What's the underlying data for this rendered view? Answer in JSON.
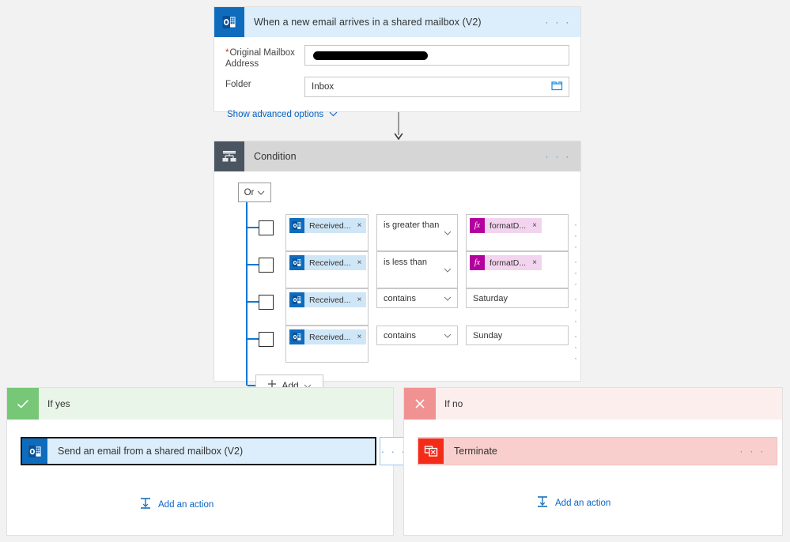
{
  "trigger": {
    "title": "When a new email arrives in a shared mailbox (V2)",
    "icon": "outlook-icon",
    "menu": "· · ·",
    "fields": [
      {
        "label": "Original Mailbox Address",
        "required": true,
        "value": "",
        "redacted": true
      },
      {
        "label": "Folder",
        "required": false,
        "value": "Inbox",
        "redacted": false,
        "trailing_icon": "folder-picker-icon"
      }
    ],
    "advanced_options_label": "Show advanced options"
  },
  "condition": {
    "title": "Condition",
    "icon": "condition-icon",
    "menu": "· · ·",
    "group_operator": "Or",
    "rows": [
      {
        "operand": "Received...",
        "operand_icon": "outlook-icon",
        "operator": "is greater than",
        "value_token": "formatD...",
        "value_token_icon": "function-icon",
        "value_text": null,
        "menu": "· · ·",
        "checked": false
      },
      {
        "operand": "Received...",
        "operand_icon": "outlook-icon",
        "operator": "is less than",
        "value_token": "formatD...",
        "value_token_icon": "function-icon",
        "value_text": null,
        "menu": "· · ·",
        "checked": false
      },
      {
        "operand": "Received...",
        "operand_icon": "outlook-icon",
        "operator": "contains",
        "value_token": null,
        "value_text": "Saturday",
        "menu": "· · ·",
        "checked": false
      },
      {
        "operand": "Received...",
        "operand_icon": "outlook-icon",
        "operator": "contains",
        "value_token": null,
        "value_text": "Sunday",
        "menu": "· · ·",
        "checked": false
      }
    ],
    "add_label": "Add",
    "remove_token_label": "×"
  },
  "branches": {
    "yes": {
      "label": "If yes",
      "icon": "checkmark-icon",
      "action": {
        "label": "Send an email from a shared mailbox (V2)",
        "icon": "outlook-icon",
        "menu": "· · ·",
        "selected": true
      },
      "add_action_label": "Add an action",
      "add_action_icon": "insert-action-icon"
    },
    "no": {
      "label": "If no",
      "icon": "cross-icon",
      "action": {
        "label": "Terminate",
        "icon": "terminate-icon",
        "menu": "· · ·",
        "selected": false
      },
      "add_action_label": "Add an action",
      "add_action_icon": "insert-action-icon"
    }
  },
  "colors": {
    "trigger_header": "#dceefb",
    "condition_header": "#d6d6d6",
    "yes_header": "#e9f5e9",
    "yes_accent": "#76c776",
    "no_header": "#fdeeee",
    "no_accent": "#f09292",
    "outlook_blue": "#0f6cbd",
    "function_magenta": "#b4009e",
    "terminate_red": "#f52b19",
    "link_blue": "#0a64c2",
    "spine_blue": "#0a78d4",
    "canvas": "#f2f2f2"
  }
}
